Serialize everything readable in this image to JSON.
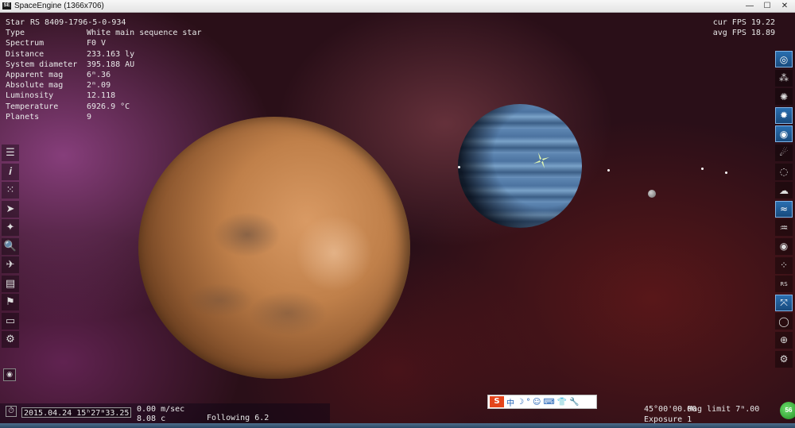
{
  "window": {
    "title": "SpaceEngine (1366x706)",
    "app_icon_text": "SE",
    "controls": {
      "minimize": "—",
      "maximize": "☐",
      "close": "✕"
    }
  },
  "info": {
    "star_label": "Star",
    "star_name": "RS 8409-1796-5-0-934",
    "rows": [
      {
        "label": "Type",
        "value": "White main sequence star"
      },
      {
        "label": "Spectrum",
        "value": "F0 V"
      },
      {
        "label": "Distance",
        "value": "233.163 ly"
      },
      {
        "label": "System diameter",
        "value": "395.188 AU"
      },
      {
        "label": "Apparent mag",
        "value": "6ᵐ.36"
      },
      {
        "label": "Absolute mag",
        "value": "2ᵐ.09"
      },
      {
        "label": "Luminosity",
        "value": "12.118"
      },
      {
        "label": "Temperature",
        "value": "6926.9 °C"
      },
      {
        "label": "Planets",
        "value": "9"
      }
    ]
  },
  "fps": {
    "cur": "cur  FPS 19.22",
    "avg": "avg  FPS 18.89"
  },
  "left_toolbar": [
    {
      "name": "menu-icon",
      "glyph": "☰"
    },
    {
      "name": "info-icon",
      "glyph": "𝒊"
    },
    {
      "name": "star-browser-icon",
      "glyph": "⁙"
    },
    {
      "name": "solar-system-icon",
      "glyph": "➤"
    },
    {
      "name": "map-icon",
      "glyph": "✦"
    },
    {
      "name": "search-icon",
      "glyph": "🔍"
    },
    {
      "name": "ship-icon",
      "glyph": "✈"
    },
    {
      "name": "script-icon",
      "glyph": "▤"
    },
    {
      "name": "tours-icon",
      "glyph": "⚑"
    },
    {
      "name": "display-icon",
      "glyph": "▭"
    },
    {
      "name": "settings-icon",
      "glyph": "⚙"
    }
  ],
  "right_toolbar": [
    {
      "name": "galaxies-icon",
      "glyph": "◎",
      "on": true
    },
    {
      "name": "clusters-icon",
      "glyph": "⁂",
      "on": false
    },
    {
      "name": "nebulae-icon",
      "glyph": "✺",
      "on": false
    },
    {
      "name": "stars-icon",
      "glyph": "✹",
      "on": true
    },
    {
      "name": "planets-icon",
      "glyph": "◉",
      "on": true
    },
    {
      "name": "comets-icon",
      "glyph": "☄",
      "on": false
    },
    {
      "name": "orbits-icon",
      "glyph": "◌",
      "on": false
    },
    {
      "name": "clouds-icon",
      "glyph": "☁",
      "on": false
    },
    {
      "name": "water-icon",
      "glyph": "≈",
      "on": true
    },
    {
      "name": "aurora-icon",
      "glyph": "♒",
      "on": false
    },
    {
      "name": "eye-icon",
      "glyph": "◉",
      "on": false
    },
    {
      "name": "constellations-icon",
      "glyph": "⁘",
      "on": false
    },
    {
      "name": "labels-icon",
      "glyph": "RS",
      "on": false
    },
    {
      "name": "markers-icon",
      "glyph": "⤧",
      "on": true
    },
    {
      "name": "ecliptic-icon",
      "glyph": "◯",
      "on": false
    },
    {
      "name": "grid-icon",
      "glyph": "⊕",
      "on": false
    },
    {
      "name": "settings-icon",
      "glyph": "⚙",
      "on": false
    }
  ],
  "bottom": {
    "datetime": "2015.04.24 15ʰ27ᵐ33.25",
    "speed": "0.00  m/sec",
    "speed2": "8.08  c",
    "following": "Following 6.2",
    "fov": "45°00'00.00",
    "exposure": "Exposure 1",
    "mag_limit": "Mag limit  7ᵐ.00"
  },
  "ime": {
    "logo": "S",
    "items": [
      "中",
      "☽",
      "°",
      "☺",
      "⌨",
      "👕",
      "🔧"
    ]
  },
  "tray_badge": "56"
}
